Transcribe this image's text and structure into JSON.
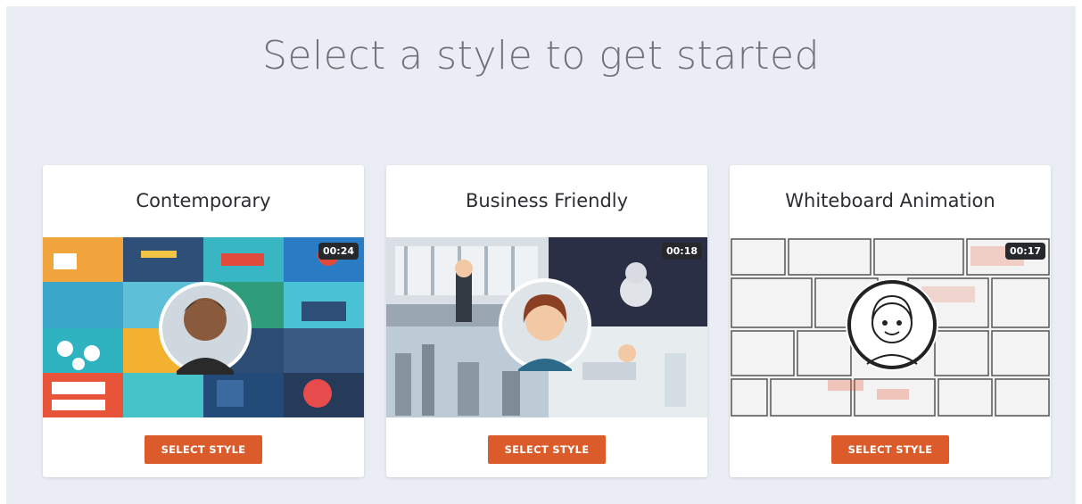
{
  "page": {
    "title": "Select a style to get started"
  },
  "styles": [
    {
      "name": "Contemporary",
      "duration": "00:24",
      "button_label": "SELECT STYLE"
    },
    {
      "name": "Business Friendly",
      "duration": "00:18",
      "button_label": "SELECT STYLE"
    },
    {
      "name": "Whiteboard Animation",
      "duration": "00:17",
      "button_label": "SELECT STYLE"
    }
  ],
  "colors": {
    "page_background": "#eaedf4",
    "button": "#db5b2b",
    "card": "#ffffff",
    "title_text": "#6f727a"
  }
}
